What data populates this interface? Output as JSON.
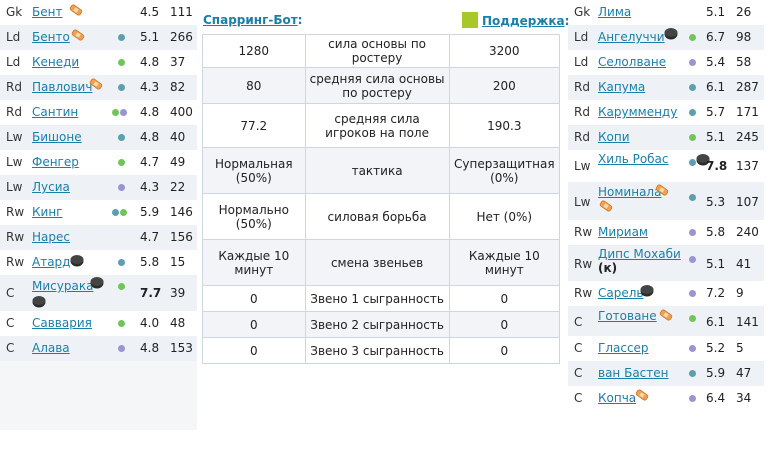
{
  "left_players": [
    {
      "pos": "Gk",
      "name": "Бент",
      "str": "4.5",
      "num": "111",
      "dots": [],
      "plaster": true,
      "puck": false,
      "bold": false
    },
    {
      "pos": "Ld",
      "name": "Бенто",
      "str": "5.1",
      "num": "266",
      "dots": [
        "#5b9fb0"
      ],
      "plaster": true,
      "puck": false,
      "bold": false
    },
    {
      "pos": "Ld",
      "name": "Кенеди",
      "str": "4.8",
      "num": "37",
      "dots": [
        "#72c45a"
      ],
      "plaster": false,
      "puck": false,
      "bold": false
    },
    {
      "pos": "Rd",
      "name": "Павлович",
      "str": "4.3",
      "num": "82",
      "dots": [
        "#5b9fb0"
      ],
      "plaster": true,
      "puck": false,
      "bold": false
    },
    {
      "pos": "Rd",
      "name": "Сантин",
      "str": "4.8",
      "num": "400",
      "dots": [
        "#72c45a",
        "#9a94d0"
      ],
      "plaster": false,
      "puck": false,
      "bold": false
    },
    {
      "pos": "Lw",
      "name": "Бишоне",
      "str": "4.8",
      "num": "40",
      "dots": [
        "#5b9fb0"
      ],
      "plaster": false,
      "puck": false,
      "bold": false
    },
    {
      "pos": "Lw",
      "name": "Фенгер",
      "str": "4.7",
      "num": "49",
      "dots": [
        "#72c45a"
      ],
      "plaster": false,
      "puck": false,
      "bold": false
    },
    {
      "pos": "Lw",
      "name": "Лусиа",
      "str": "4.3",
      "num": "22",
      "dots": [
        "#9a94d0"
      ],
      "plaster": false,
      "puck": false,
      "bold": false
    },
    {
      "pos": "Rw",
      "name": "Кинг",
      "str": "5.9",
      "num": "146",
      "dots": [
        "#5b9fb0",
        "#72c45a"
      ],
      "plaster": false,
      "puck": false,
      "bold": false
    },
    {
      "pos": "Rw",
      "name": "Нарес",
      "str": "4.7",
      "num": "156",
      "dots": [],
      "plaster": false,
      "puck": false,
      "bold": false
    },
    {
      "pos": "Rw",
      "name": "Атард",
      "str": "5.8",
      "num": "15",
      "dots": [
        "#5b9fb0"
      ],
      "plaster": false,
      "puck": true,
      "bold": false
    },
    {
      "pos": "C",
      "name": "Мисурака",
      "str": "7.7",
      "num": "39",
      "dots": [
        "#72c45a"
      ],
      "plaster": false,
      "puck": true,
      "bold": true
    },
    {
      "pos": "C",
      "name": "Саввария",
      "str": "4.0",
      "num": "48",
      "dots": [
        "#72c45a"
      ],
      "plaster": false,
      "puck": false,
      "bold": false
    },
    {
      "pos": "C",
      "name": "Алава",
      "str": "4.8",
      "num": "153",
      "dots": [
        "#9a94d0"
      ],
      "plaster": false,
      "puck": false,
      "bold": false
    }
  ],
  "right_players": [
    {
      "pos": "Gk",
      "name": "Лима",
      "str": "5.1",
      "num": "26",
      "dots": [],
      "plaster": false,
      "puck": false,
      "bold": false
    },
    {
      "pos": "Ld",
      "name": "Ангелуччи",
      "str": "6.7",
      "num": "98",
      "dots": [
        "#72c45a"
      ],
      "plaster": false,
      "puck": true,
      "bold": false
    },
    {
      "pos": "Ld",
      "name": "Селолване",
      "str": "5.4",
      "num": "58",
      "dots": [
        "#9a94d0"
      ],
      "plaster": false,
      "puck": false,
      "bold": false
    },
    {
      "pos": "Rd",
      "name": "Капума",
      "str": "6.1",
      "num": "287",
      "dots": [
        "#5b9fb0"
      ],
      "plaster": false,
      "puck": false,
      "bold": false
    },
    {
      "pos": "Rd",
      "name": "Карумменду",
      "str": "5.7",
      "num": "171",
      "dots": [
        "#5b9fb0"
      ],
      "plaster": false,
      "puck": false,
      "bold": false
    },
    {
      "pos": "Rd",
      "name": "Копи",
      "str": "5.1",
      "num": "245",
      "dots": [
        "#72c45a"
      ],
      "plaster": false,
      "puck": false,
      "bold": false
    },
    {
      "pos": "Lw",
      "name": "Хиль Робас",
      "str": "7.8",
      "num": "137",
      "dots": [
        "#5b9fb0"
      ],
      "plaster": false,
      "puck": true,
      "bold": true
    },
    {
      "pos": "Lw",
      "name": "Номинала",
      "str": "5.3",
      "num": "107",
      "dots": [
        "#5b9fb0"
      ],
      "plaster": true,
      "puck": false,
      "bold": false
    },
    {
      "pos": "Rw",
      "name": "Мириам",
      "str": "5.8",
      "num": "240",
      "dots": [
        "#9a94d0"
      ],
      "plaster": false,
      "puck": false,
      "bold": false
    },
    {
      "pos": "Rw",
      "name": "Дипс Мохаби",
      "suffix": "(к)",
      "str": "5.1",
      "num": "41",
      "dots": [
        "#9a94d0"
      ],
      "plaster": false,
      "puck": false,
      "bold": false
    },
    {
      "pos": "Rw",
      "name": "Сарель",
      "str": "7.2",
      "num": "9",
      "dots": [
        "#9a94d0"
      ],
      "plaster": false,
      "puck": true,
      "bold": false
    },
    {
      "pos": "C",
      "name": "Готоване",
      "str": "6.1",
      "num": "141",
      "dots": [
        "#72c45a"
      ],
      "plaster": true,
      "puck": false,
      "bold": false
    },
    {
      "pos": "C",
      "name": "Глассер",
      "str": "5.2",
      "num": "5",
      "dots": [
        "#9a94d0"
      ],
      "plaster": false,
      "puck": false,
      "bold": false
    },
    {
      "pos": "C",
      "name": "ван Бастен",
      "str": "5.9",
      "num": "47",
      "dots": [
        "#5b9fb0"
      ],
      "plaster": false,
      "puck": false,
      "bold": false
    },
    {
      "pos": "C",
      "name": "Копча",
      "str": "6.4",
      "num": "34",
      "dots": [
        "#9a94d0"
      ],
      "plaster": true,
      "puck": false,
      "bold": false
    }
  ],
  "header": {
    "left_link": "Спарринг-Бот",
    "left_colon": ":",
    "right_link": "Поддержка",
    "right_colon": ":"
  },
  "mid_rows": [
    {
      "l": "1280",
      "c": "сила основы по ростеру",
      "r": "3200"
    },
    {
      "l": "80",
      "c": "средняя сила основы по ростеру",
      "r": "200"
    },
    {
      "l": "77.2",
      "c": "средняя сила игроков на поле",
      "r": "190.3"
    },
    {
      "l": "Нормальная (50%)",
      "c": "тактика",
      "r": "Суперзащитная (0%)"
    },
    {
      "l": "Нормально (50%)",
      "c": "силовая борьба",
      "r": "Нет (0%)"
    },
    {
      "l": "Каждые 10 минут",
      "c": "смена звеньев",
      "r": "Каждые 10 минут"
    },
    {
      "l": "0",
      "c": "Звено 1 сыгранность",
      "r": "0"
    },
    {
      "l": "0",
      "c": "Звено 2 сыгранность",
      "r": "0"
    },
    {
      "l": "0",
      "c": "Звено 3 сыгранность",
      "r": "0"
    }
  ],
  "colors": {
    "link": "#1a7fa8",
    "highlight": "#f6f600",
    "support_square": "#a8c72a"
  }
}
